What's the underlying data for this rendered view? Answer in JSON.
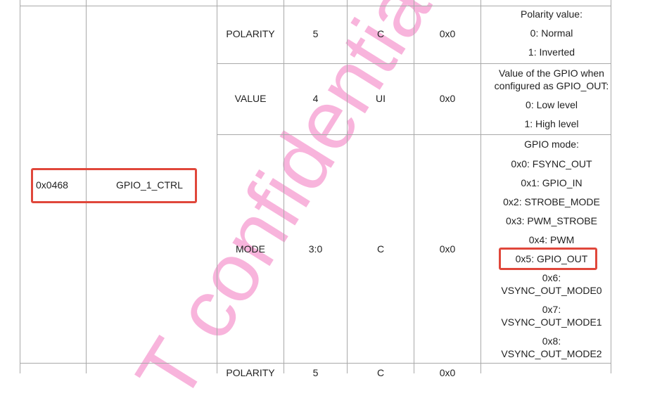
{
  "register": {
    "address": "0x0468",
    "name": "GPIO_1_CTRL"
  },
  "rows": [
    {
      "field": "POLARITY",
      "bits": "5",
      "access": "C",
      "reset": "0x0",
      "description": [
        "Polarity value:",
        "0: Normal",
        "1: Inverted"
      ]
    },
    {
      "field": "VALUE",
      "bits": "4",
      "access": "UI",
      "reset": "0x0",
      "description": [
        "Value of the GPIO when",
        "configured as GPIO_OUT:",
        "0: Low level",
        "1: High level"
      ]
    },
    {
      "field": "MODE",
      "bits": "3:0",
      "access": "C",
      "reset": "0x0",
      "description": [
        "GPIO mode:",
        "0x0: FSYNC_OUT",
        "0x1: GPIO_IN",
        "0x2: STROBE_MODE",
        "0x3: PWM_STROBE",
        "0x4: PWM",
        "0x5: GPIO_OUT",
        "0x6:",
        "VSYNC_OUT_MODE0",
        "0x7:",
        "VSYNC_OUT_MODE1",
        "0x8:",
        "VSYNC_OUT_MODE2"
      ]
    }
  ],
  "next_row_partial": {
    "field": "POLARITY",
    "bits": "5",
    "access": "C",
    "reset": "0x0"
  },
  "watermark": "T confidential",
  "colors": {
    "grid": "#a9a9a9",
    "highlight": "#e0473b",
    "watermark": "#f7a8d6"
  }
}
